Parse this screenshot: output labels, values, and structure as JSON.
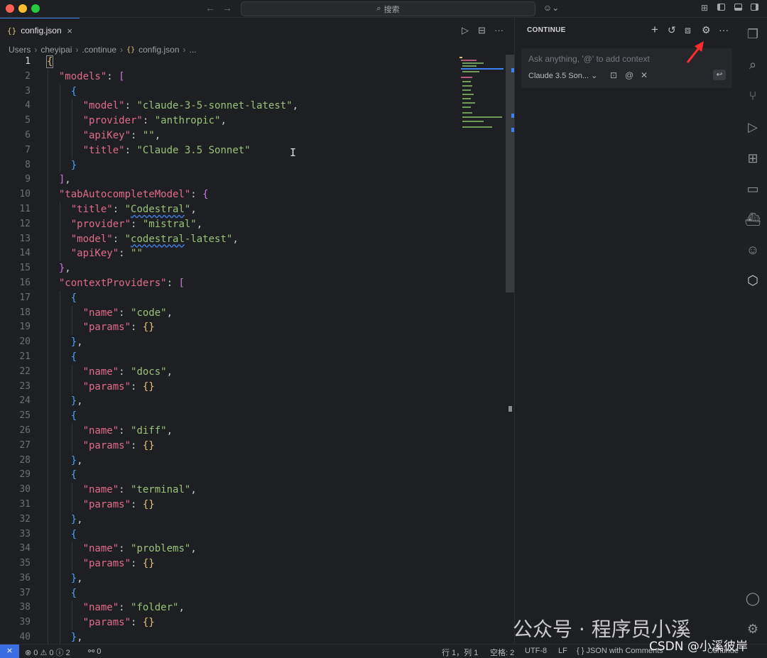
{
  "titlebar": {
    "search_placeholder": "搜索"
  },
  "tab": {
    "label": "config.json",
    "icon": "{}",
    "close": "×"
  },
  "breadcrumb": [
    "Users",
    "cheyipai",
    ".continue",
    "config.json",
    "..."
  ],
  "editor": {
    "line_numbers": [
      "1",
      "2",
      "3",
      "4",
      "5",
      "6",
      "7",
      "8",
      "9",
      "10",
      "11",
      "12",
      "13",
      "14",
      "15",
      "16",
      "17",
      "18",
      "19",
      "20",
      "21",
      "22",
      "23",
      "24",
      "25",
      "26",
      "27",
      "28",
      "29",
      "30",
      "31",
      "32",
      "33",
      "34",
      "35",
      "36",
      "37",
      "38",
      "39",
      "40"
    ],
    "active_line": "1"
  },
  "continue_panel": {
    "title": "CONTINUE",
    "chat_placeholder": "Ask anything, '@' to add context",
    "model": "Claude 3.5 Son...",
    "enter_glyph": "↩"
  },
  "statusbar": {
    "problems": "⊗ 0 ⚠ 0 ⓘ 2",
    "ports": "⚯ 0",
    "position": "行 1，列 1",
    "spaces": "空格: 2",
    "encoding": "UTF-8",
    "eol": "LF",
    "language": "{ } JSON with Comments",
    "extension": "Continue"
  },
  "watermark": {
    "line1": "公众号 · 程序员小溪",
    "line2": "CSDN @小溪彼岸"
  },
  "colors": {
    "accent": "#3b82f6",
    "arrow": "#ff2d2d",
    "background": "#1e1f22"
  }
}
